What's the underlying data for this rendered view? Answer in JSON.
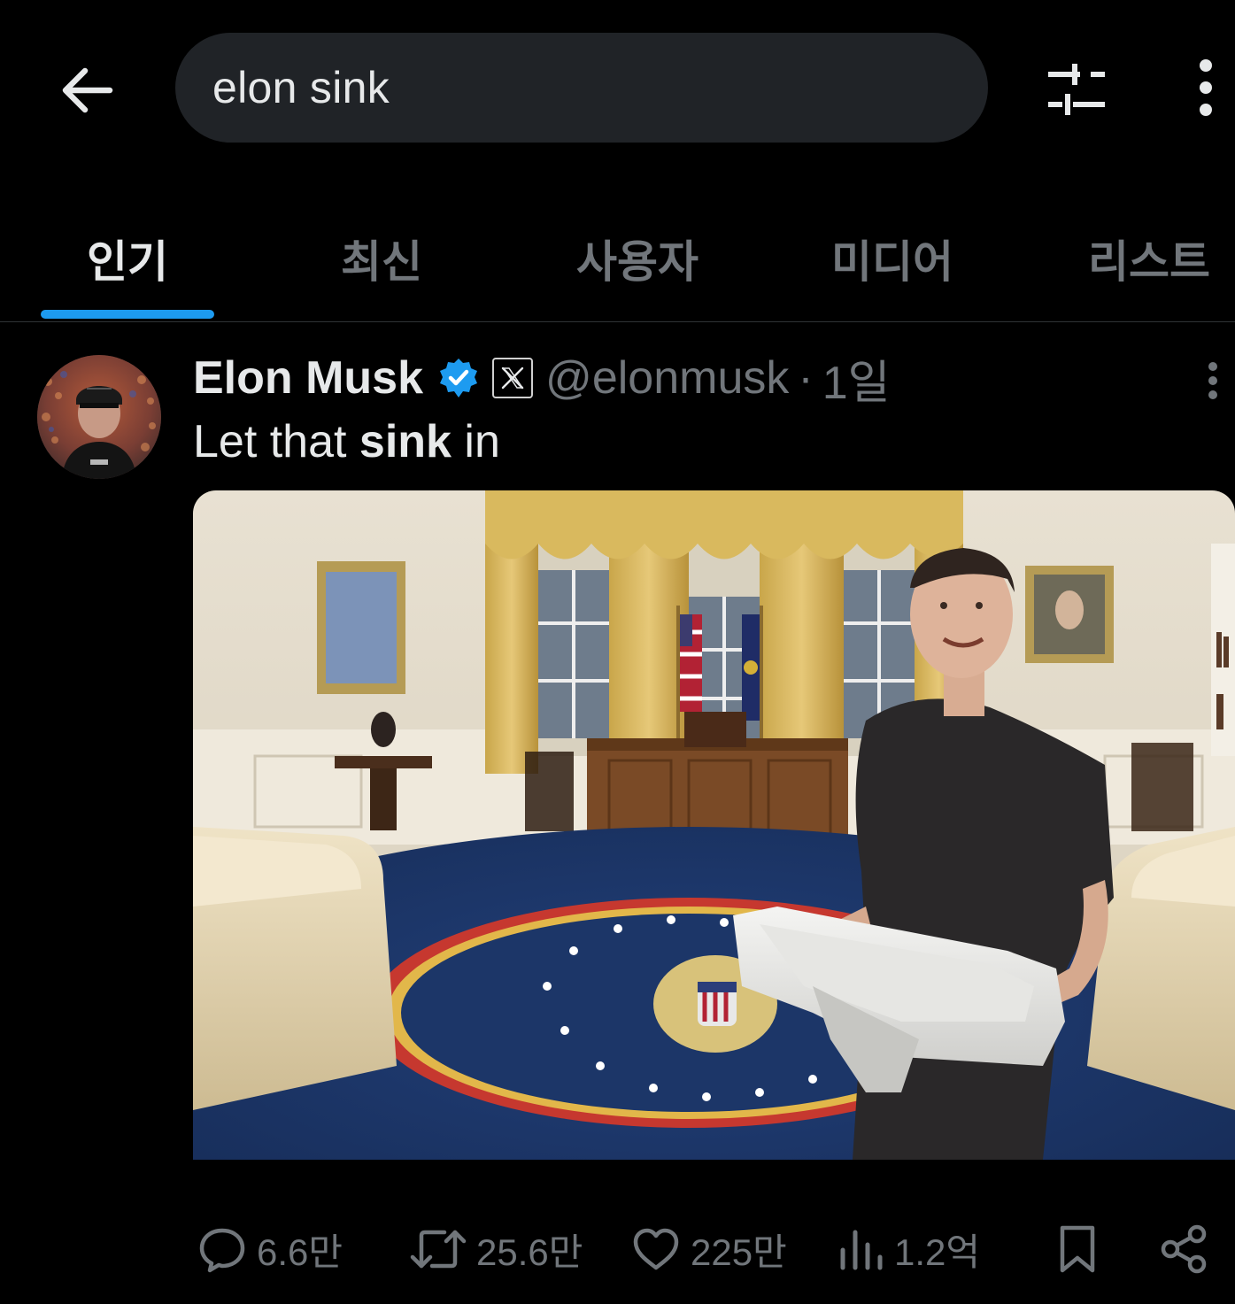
{
  "search": {
    "query": "elon sink"
  },
  "tabs": [
    {
      "label": "인기"
    },
    {
      "label": "최신"
    },
    {
      "label": "사용자"
    },
    {
      "label": "미디어"
    },
    {
      "label": "리스트"
    }
  ],
  "tweet": {
    "author_name": "Elon Musk",
    "handle": "@elonmusk",
    "separator": "·",
    "timestamp": "1일",
    "text_before": "Let that ",
    "text_bold": "sink",
    "text_after": " in",
    "metrics": {
      "replies": "6.6만",
      "reposts": "25.6만",
      "likes": "225만",
      "views": "1.2억"
    }
  },
  "colors": {
    "background": "#000000",
    "accent": "#1d9bf0",
    "muted": "#71767b",
    "text": "#e7e9ea",
    "search_bg": "#202327"
  },
  "icons": [
    "back-arrow-icon",
    "filter-sliders-icon",
    "more-vertical-icon",
    "verified-badge-icon",
    "x-logo-icon",
    "reply-icon",
    "repost-icon",
    "like-icon",
    "views-icon",
    "bookmark-icon",
    "share-icon"
  ]
}
